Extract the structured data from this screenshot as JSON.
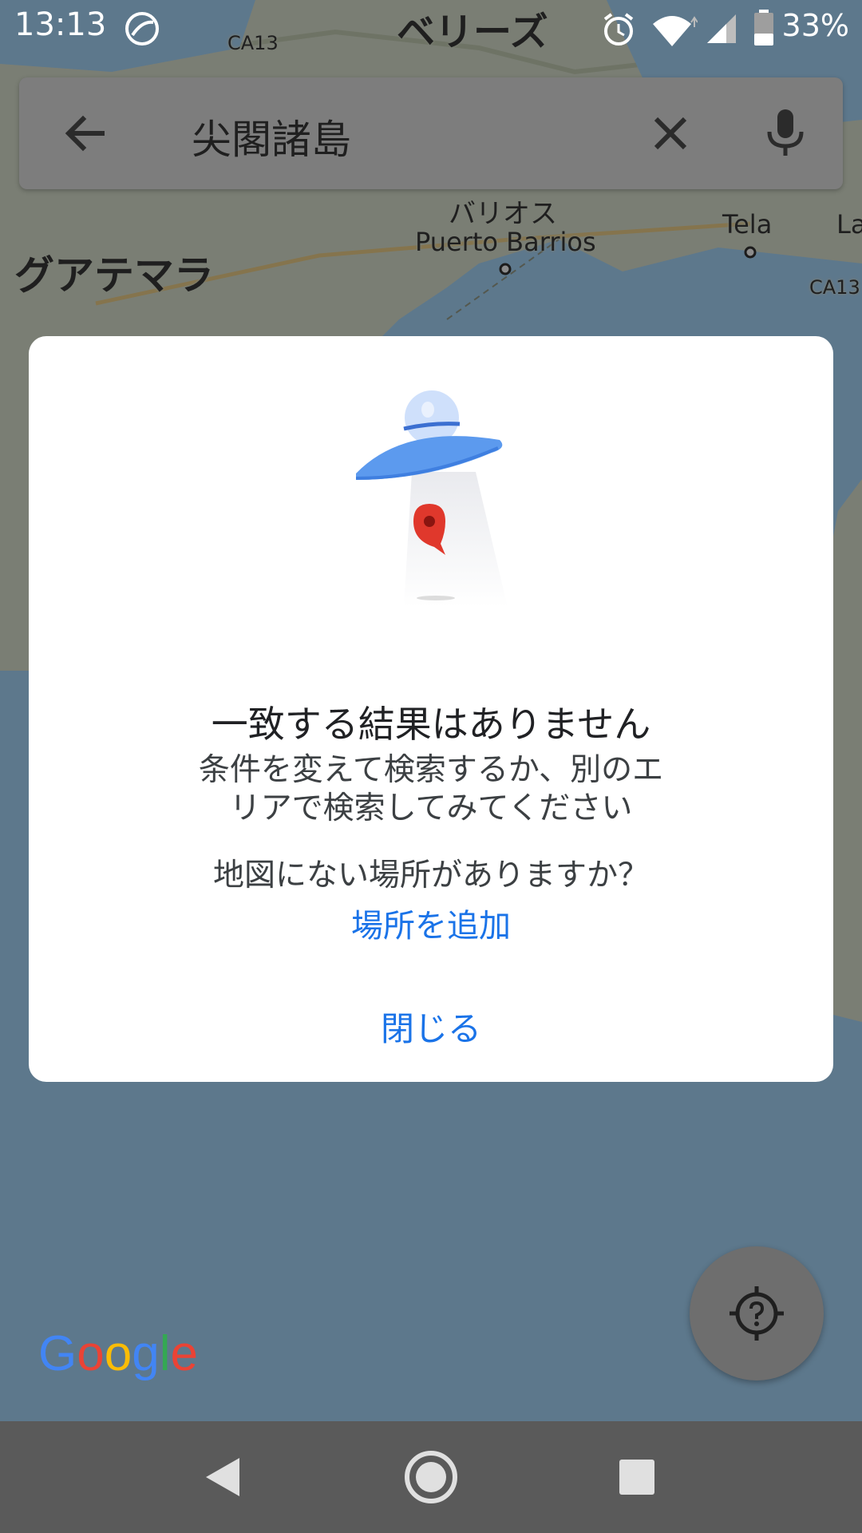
{
  "status_bar": {
    "time": "13:13",
    "battery_percent": "33%"
  },
  "search": {
    "query": "尖閣諸島"
  },
  "map": {
    "labels": {
      "belize": "ベリーズ",
      "guatemala": "グアテマラ",
      "puerto_barrios_kana": "バリオス",
      "puerto_barrios": "Puerto Barrios",
      "tela": "Tela",
      "la": "La",
      "road_ca13_top": "CA13",
      "road_ca13_right": "CA13"
    }
  },
  "dialog": {
    "title": "一致する結果はありません",
    "message_line1": "条件を変えて検索するか、別のエ",
    "message_line2": "リアで検索してみてください",
    "question": "地図にない場所がありますか？",
    "add_place_link": "場所を追加",
    "close_button": "閉じる"
  },
  "branding": {
    "logo_text": "Google"
  },
  "colors": {
    "accent": "#1a73e8",
    "dialog_background": "#ffffff",
    "scrim": "rgba(0,0,0,0.45)"
  }
}
